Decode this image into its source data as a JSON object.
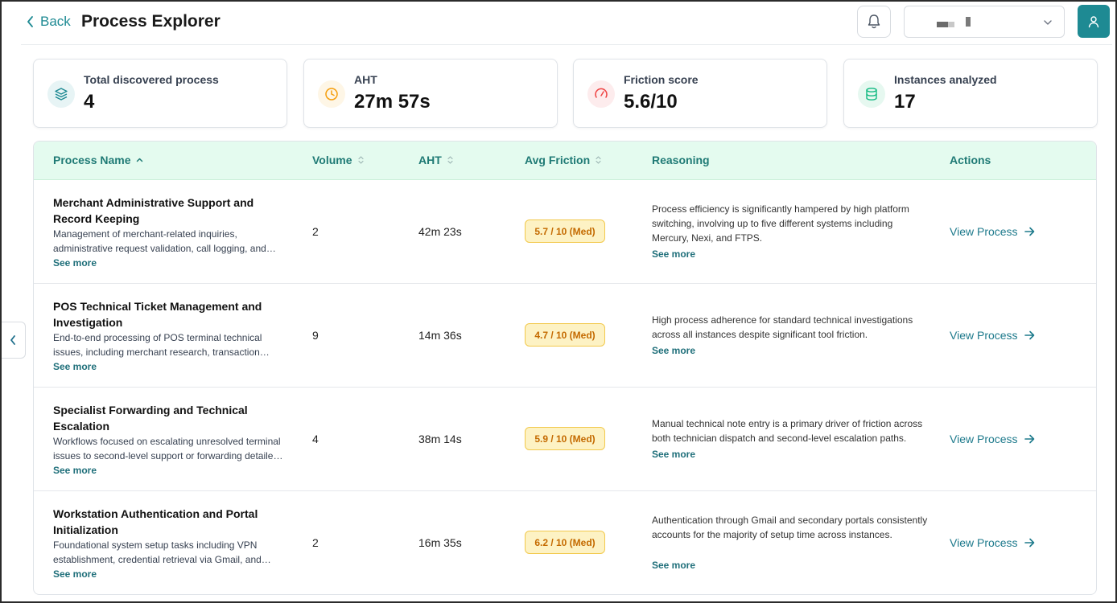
{
  "header": {
    "back_label": "Back",
    "title": "Process Explorer"
  },
  "stats": [
    {
      "label": "Total discovered process",
      "value": "4",
      "icon": "layers-icon",
      "color": "#1e8a93"
    },
    {
      "label": "AHT",
      "value": "27m 57s",
      "icon": "clock-icon",
      "color": "#f59e0b"
    },
    {
      "label": "Friction score",
      "value": "5.6/10",
      "icon": "gauge-icon",
      "color": "#ef4444"
    },
    {
      "label": "Instances analyzed",
      "value": "17",
      "icon": "database-icon",
      "color": "#10b981"
    }
  ],
  "table": {
    "columns": {
      "name": "Process Name",
      "volume": "Volume",
      "aht": "AHT",
      "friction": "Avg Friction",
      "reasoning": "Reasoning",
      "actions": "Actions"
    },
    "see_more": "See more",
    "view_label": "View Process",
    "rows": [
      {
        "name": "Merchant Administrative Support and Record Keeping",
        "description": "Management of merchant-related inquiries, administrative request validation, call logging, and data updates across systems.",
        "volume": "2",
        "aht": "42m 23s",
        "friction": "5.7 / 10 (Med)",
        "reasoning": "Process efficiency is significantly hampered by high platform switching, involving up to five different systems including Mercury, Nexi, and FTPS."
      },
      {
        "name": "POS Technical Ticket Management and Investigation",
        "description": "End-to-end processing of POS terminal technical issues, including merchant research, transaction review and ticket handling.",
        "volume": "9",
        "aht": "14m 36s",
        "friction": "4.7 / 10 (Med)",
        "reasoning": "High process adherence for standard technical investigations across all instances despite significant tool friction."
      },
      {
        "name": "Specialist Forwarding and Technical Escalation",
        "description": "Workflows focused on escalating unresolved terminal issues to second-level support or forwarding detailed technical notes.",
        "volume": "4",
        "aht": "38m 14s",
        "friction": "5.9 / 10 (Med)",
        "reasoning": "Manual technical note entry is a primary driver of friction across both technician dispatch and second-level escalation paths."
      },
      {
        "name": "Workstation Authentication and Portal Initialization",
        "description": "Foundational system setup tasks including VPN establishment, credential retrieval via Gmail, and portal initialization.",
        "volume": "2",
        "aht": "16m 35s",
        "friction": "6.2 / 10 (Med)",
        "reasoning": "Authentication through Gmail and secondary portals consistently accounts for the majority of setup time across instances."
      }
    ]
  }
}
